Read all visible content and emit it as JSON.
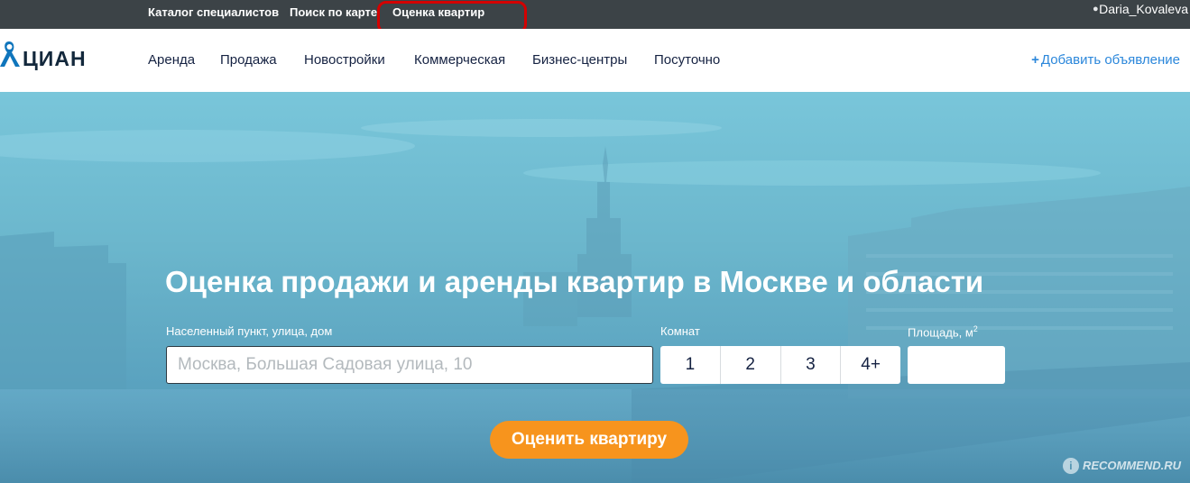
{
  "topbar": {
    "links": [
      "Каталог специалистов",
      "Поиск по карте",
      "Оценка квартир"
    ],
    "user": "Daria_Kovaleva"
  },
  "logo": {
    "text": "ЦИАН",
    "color": "#13283c"
  },
  "nav": {
    "items": [
      "Аренда",
      "Продажа",
      "Новостройки",
      "Коммерческая",
      "Бизнес-центры",
      "Посуточно"
    ],
    "add_label": "Добавить объявление",
    "add_plus": "+"
  },
  "hero": {
    "title": "Оценка продажи и аренды квартир в Москве и области",
    "address_label": "Населенный пункт, улица, дом",
    "address_placeholder": "Москва, Большая Садовая улица, 10",
    "address_value": "",
    "rooms_label": "Комнат",
    "rooms": [
      "1",
      "2",
      "3",
      "4+"
    ],
    "area_label": "Площадь, м",
    "area_sup": "2",
    "area_value": "",
    "submit_label": "Оценить квартиру"
  },
  "watermark": {
    "badge": "i",
    "text": "RECOMMEND.RU"
  },
  "colors": {
    "topbar": "#3c4347",
    "link_blue": "#2b87db",
    "button_orange": "#f7941d",
    "highlight_red": "#d40000"
  }
}
